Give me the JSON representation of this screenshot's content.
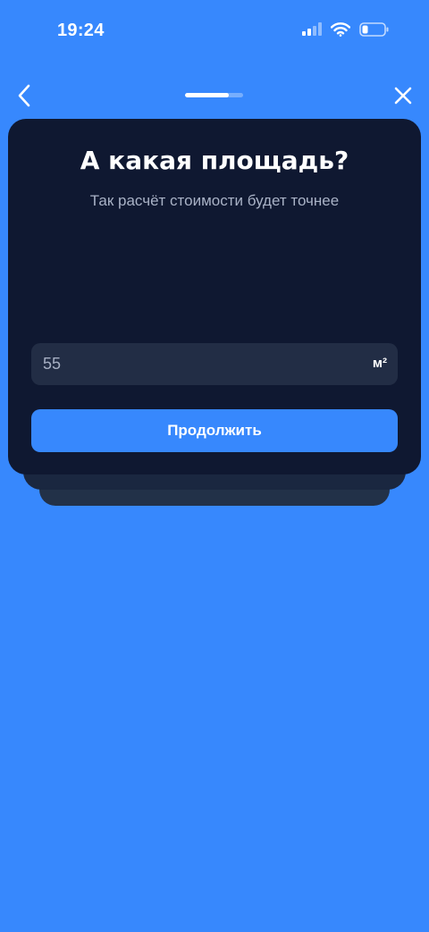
{
  "status_bar": {
    "time": "19:24",
    "icons": [
      "cellular-signal-icon",
      "wifi-icon",
      "battery-icon"
    ]
  },
  "nav": {
    "back_icon": "chevron-left-icon",
    "close_icon": "close-icon",
    "progress_fraction": 0.75
  },
  "card": {
    "title": "А какая площадь?",
    "subtitle": "Так расчёт стоимости будет точнее"
  },
  "area_field": {
    "value": "55",
    "unit": "м²"
  },
  "continue_button": {
    "label": "Продолжить"
  },
  "colors": {
    "background": "#3788fd",
    "card": "#0f1831",
    "field": "#222d45",
    "button": "#3788fd"
  }
}
